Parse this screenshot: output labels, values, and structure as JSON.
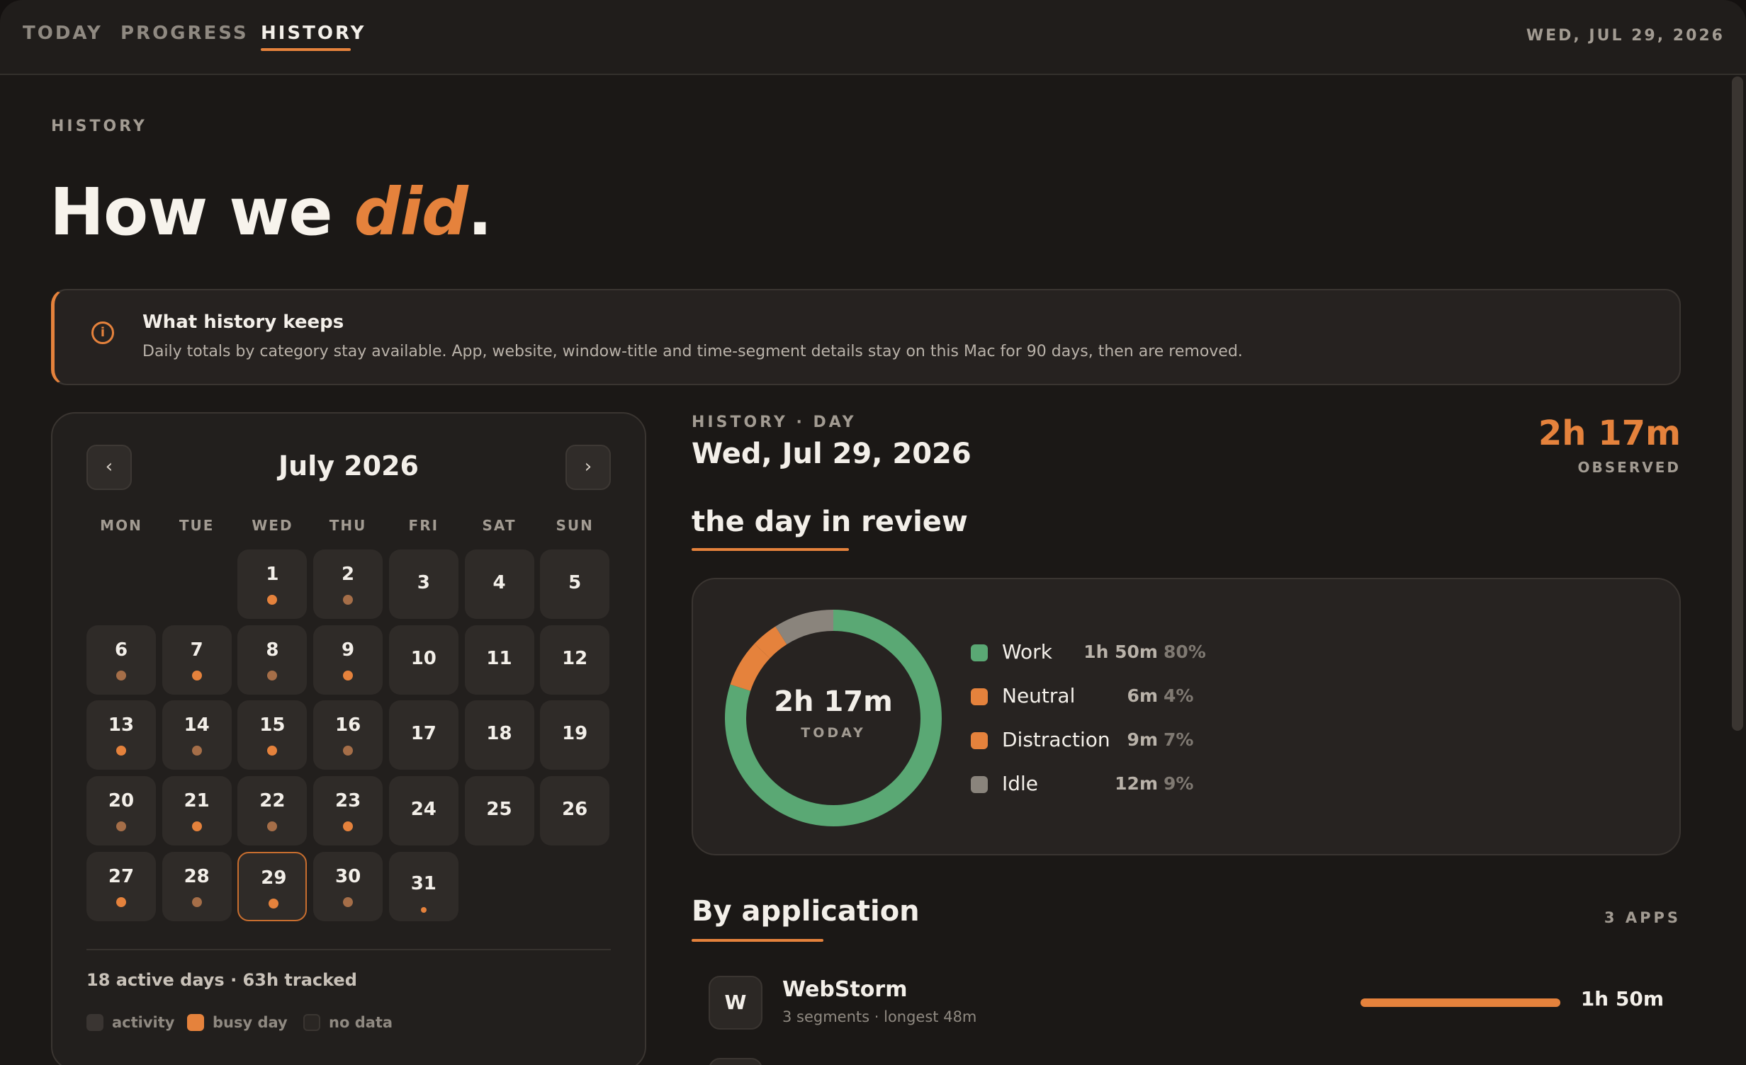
{
  "nav": {
    "tabs": [
      {
        "label": "TODAY"
      },
      {
        "label": "PROGRESS"
      },
      {
        "label": "HISTORY"
      }
    ],
    "date": "WED, JUL 29, 2026"
  },
  "header": {
    "eyebrow": "HISTORY",
    "title_lead": "How we ",
    "title_accent": "did",
    "title_end": "."
  },
  "info": {
    "icon": "info-icon",
    "title": "What history keeps",
    "body": "Daily totals by category stay available. App, website, window-title and time-segment details stay on this Mac for 90 days, then are removed."
  },
  "calendar": {
    "title": "July 2026",
    "prev_label": "‹",
    "next_label": "›",
    "weekdays": [
      "MON",
      "TUE",
      "WED",
      "THU",
      "FRI",
      "SAT",
      "SUN"
    ],
    "summary": "18 active days · 63h tracked",
    "legend": [
      {
        "label": "activity",
        "color": "#3a3532"
      },
      {
        "label": "busy day",
        "color": "#e5823c"
      },
      {
        "label": "no data",
        "color": "#2a2623"
      }
    ],
    "days": [
      {
        "day": "1",
        "dot": "busy"
      },
      {
        "day": "2",
        "dot": "activity"
      },
      {
        "day": "3",
        "dot": "none"
      },
      {
        "day": "4",
        "dot": "none"
      },
      {
        "day": "5",
        "dot": "none"
      },
      {
        "day": "6",
        "dot": "activity"
      },
      {
        "day": "7",
        "dot": "busy"
      },
      {
        "day": "8",
        "dot": "activity"
      },
      {
        "day": "9",
        "dot": "busy"
      },
      {
        "day": "10",
        "dot": "none"
      },
      {
        "day": "11",
        "dot": "none"
      },
      {
        "day": "12",
        "dot": "none"
      },
      {
        "day": "13",
        "dot": "busy"
      },
      {
        "day": "14",
        "dot": "activity"
      },
      {
        "day": "15",
        "dot": "busy"
      },
      {
        "day": "16",
        "dot": "activity"
      },
      {
        "day": "17",
        "dot": "none"
      },
      {
        "day": "18",
        "dot": "none"
      },
      {
        "day": "19",
        "dot": "none"
      },
      {
        "day": "20",
        "dot": "activity"
      },
      {
        "day": "21",
        "dot": "busy"
      },
      {
        "day": "22",
        "dot": "activity"
      },
      {
        "day": "23",
        "dot": "busy"
      },
      {
        "day": "24",
        "dot": "none"
      },
      {
        "day": "25",
        "dot": "none"
      },
      {
        "day": "26",
        "dot": "none"
      },
      {
        "day": "27",
        "dot": "busy"
      },
      {
        "day": "28",
        "dot": "activity"
      },
      {
        "day": "29",
        "dot": "busy",
        "selected": true
      },
      {
        "day": "30",
        "dot": "activity"
      },
      {
        "day": "31",
        "dot": "small"
      }
    ]
  },
  "day_detail": {
    "eyebrow": "HISTORY · DAY",
    "title": "Wed, Jul 29, 2026",
    "observed_value": "2h 17m",
    "observed_label": "OBSERVED"
  },
  "review": {
    "title": "the day in review",
    "total": "2h 17m",
    "total_label": "TODAY",
    "categories": [
      {
        "name": "Work",
        "time": "1h 50m",
        "pct": "80%",
        "fraction": 0.8,
        "color": "#5aa874"
      },
      {
        "name": "Neutral",
        "time": "6m",
        "pct": "4%",
        "fraction": 0.04,
        "color": "#e5823c"
      },
      {
        "name": "Distraction",
        "time": "9m",
        "pct": "7%",
        "fraction": 0.07,
        "color": "#e5823c"
      },
      {
        "name": "Idle",
        "time": "12m",
        "pct": "9%",
        "fraction": 0.09,
        "color": "#8a847c"
      }
    ]
  },
  "apps": {
    "title": "By application",
    "count": "3 APPS",
    "items": [
      {
        "initial": "W",
        "name": "WebStorm",
        "meta": "3 segments · longest 48m",
        "time": "1h 50m"
      }
    ]
  }
}
